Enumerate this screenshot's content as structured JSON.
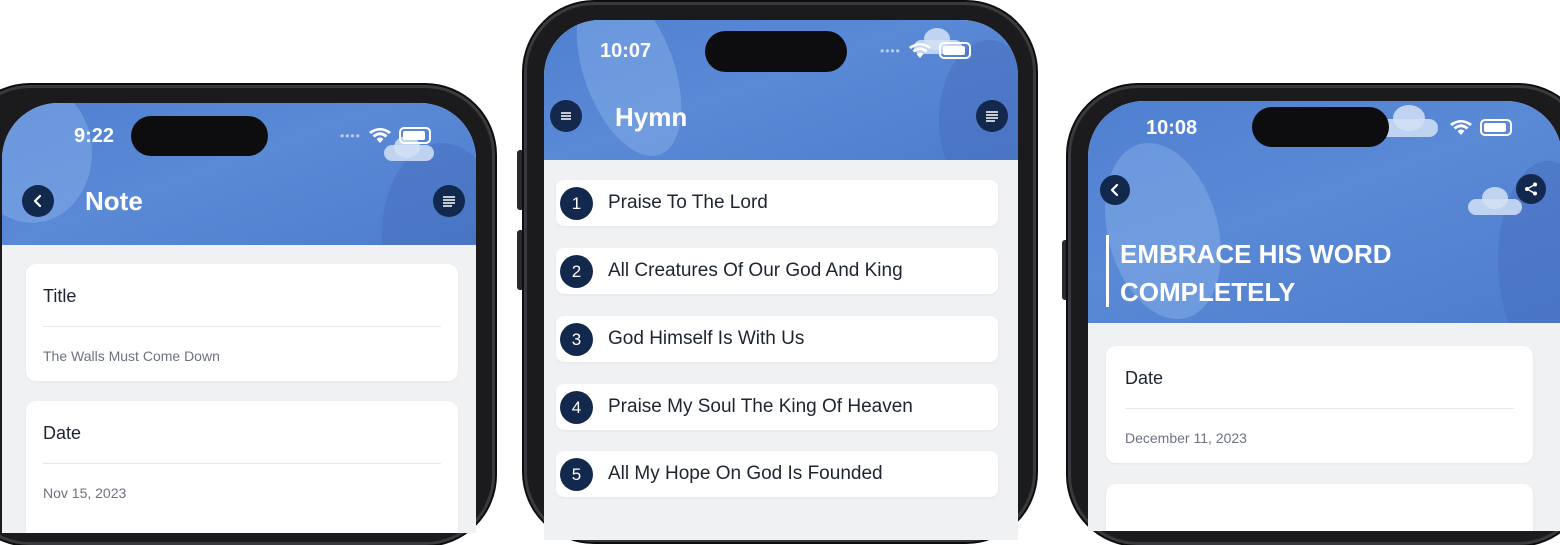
{
  "phones": {
    "note": {
      "status_time": "9:22",
      "title": "Note",
      "fields": [
        {
          "label": "Title",
          "value": "The Walls Must Come Down"
        },
        {
          "label": "Date",
          "value": "Nov 15, 2023"
        }
      ]
    },
    "hymn": {
      "status_time": "10:07",
      "title": "Hymn",
      "hymns": [
        {
          "number": "1",
          "title": "Praise To The Lord"
        },
        {
          "number": "2",
          "title": "All Creatures Of Our God And King"
        },
        {
          "number": "3",
          "title": "God Himself Is With Us"
        },
        {
          "number": "4",
          "title": "Praise My Soul The King Of Heaven"
        },
        {
          "number": "5",
          "title": "All My Hope On God Is Founded"
        }
      ]
    },
    "devotion": {
      "status_time": "10:08",
      "heading_line1": "EMBRACE HIS WORD",
      "heading_line2": "COMPLETELY",
      "fields": [
        {
          "label": "Date",
          "value": "December 11, 2023"
        }
      ]
    }
  },
  "colors": {
    "header_blue": "#5585d3",
    "badge_navy": "#12284d",
    "background": "#f0f1f3"
  },
  "icons": [
    "back-icon",
    "menu-lines-icon",
    "share-icon",
    "wifi-icon",
    "battery-icon"
  ]
}
